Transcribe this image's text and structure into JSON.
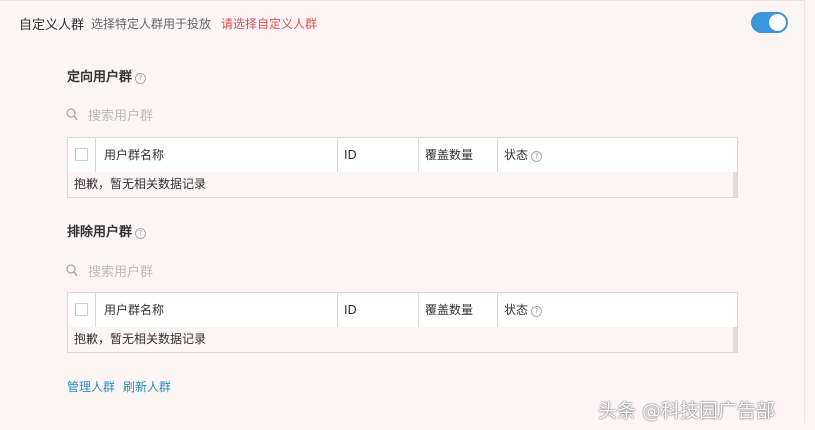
{
  "header": {
    "title": "自定义人群",
    "desc": "选择特定人群用于投放",
    "warn": "请选择自定义人群"
  },
  "toggle": {
    "state": "on"
  },
  "include": {
    "title": "定向用户群",
    "search_placeholder": "搜索用户群",
    "columns": [
      "用户群名称",
      "ID",
      "覆盖数量",
      "状态"
    ],
    "empty_text": "抱歉，暂无相关数据记录"
  },
  "exclude": {
    "title": "排除用户群",
    "search_placeholder": "搜索用户群",
    "columns": [
      "用户群名称",
      "ID",
      "覆盖数量",
      "状态"
    ],
    "empty_text": "抱歉，暂无相关数据记录"
  },
  "footer": {
    "manage": "管理人群",
    "refresh": "刷新人群"
  },
  "watermark": "头条 @科技园广告部",
  "colors": {
    "accent": "#3a97dd",
    "warn": "#d9534f",
    "link": "#2a8fbd",
    "background": "#fdf4f6"
  }
}
